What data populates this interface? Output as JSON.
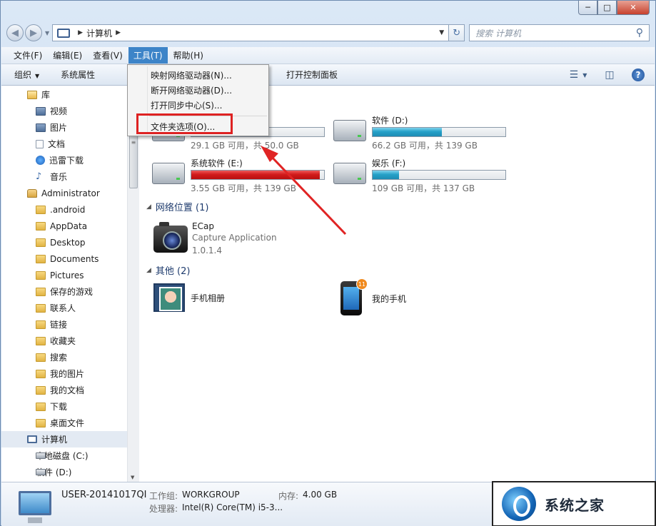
{
  "window": {
    "min": "─",
    "max": "□",
    "close": "✕"
  },
  "address": {
    "path": "计算机",
    "search_placeholder": "搜索 计算机"
  },
  "menubar": [
    "文件(F)",
    "编辑(E)",
    "查看(V)",
    "工具(T)",
    "帮助(H)"
  ],
  "cmdbar": {
    "organize": "组织",
    "system_props": "系统属性",
    "open_cp": "打开控制面板"
  },
  "tools_menu": [
    "映射网络驱动器(N)...",
    "断开网络驱动器(D)...",
    "打开同步中心(S)...",
    "文件夹选项(O)..."
  ],
  "nav": [
    {
      "label": "库",
      "icon": "lib"
    },
    {
      "label": "视频",
      "icon": "media"
    },
    {
      "label": "图片",
      "icon": "media"
    },
    {
      "label": "文档",
      "icon": "doc"
    },
    {
      "label": "迅雷下载",
      "icon": "xl"
    },
    {
      "label": "音乐",
      "icon": "note"
    },
    {
      "label": "Administrator",
      "icon": "user"
    },
    {
      "label": ".android",
      "icon": "folder"
    },
    {
      "label": "AppData",
      "icon": "folder"
    },
    {
      "label": "Desktop",
      "icon": "folder"
    },
    {
      "label": "Documents",
      "icon": "folder"
    },
    {
      "label": "Pictures",
      "icon": "folder"
    },
    {
      "label": "保存的游戏",
      "icon": "folder"
    },
    {
      "label": "联系人",
      "icon": "folder"
    },
    {
      "label": "链接",
      "icon": "folder"
    },
    {
      "label": "收藏夹",
      "icon": "folder"
    },
    {
      "label": "搜索",
      "icon": "folder"
    },
    {
      "label": "我的图片",
      "icon": "folder"
    },
    {
      "label": "我的文档",
      "icon": "folder"
    },
    {
      "label": "下载",
      "icon": "folder"
    },
    {
      "label": "桌面文件",
      "icon": "folder"
    },
    {
      "label": "计算机",
      "icon": "pc"
    },
    {
      "label": "本地磁盘 (C:)",
      "icon": "drive"
    },
    {
      "label": "软件 (D:)",
      "icon": "drive"
    }
  ],
  "drives": [
    {
      "name": "",
      "free": "29.1 GB 可用，共 50.0 GB",
      "used_fraction": 0.42,
      "color": "blue"
    },
    {
      "name": "软件 (D:)",
      "free": "66.2 GB 可用，共 139 GB",
      "used_fraction": 0.52,
      "color": "blue"
    },
    {
      "name": "系统软件 (E:)",
      "free": "3.55 GB 可用，共 139 GB",
      "used_fraction": 0.97,
      "color": "red"
    },
    {
      "name": "娱乐 (F:)",
      "free": "109 GB 可用，共 137 GB",
      "used_fraction": 0.2,
      "color": "blue"
    }
  ],
  "groups": {
    "network": "网络位置 (1)",
    "other": "其他 (2)"
  },
  "ecap": {
    "name": "ECap",
    "desc": "Capture Application",
    "version": "1.0.1.4"
  },
  "other_items": {
    "album": "手机相册",
    "phone": "我的手机",
    "badge": "11"
  },
  "details": {
    "pc_name": "USER-20141017QI",
    "workgroup_label": "工作组:",
    "workgroup": "WORKGROUP",
    "memory_label": "内存:",
    "memory": "4.00 GB",
    "cpu_label": "处理器:",
    "cpu": "Intel(R) Core(TM) i5-3..."
  },
  "watermark": "系统之家",
  "colors": {
    "menu_active": "#3d84c8",
    "highlight": "#de2222",
    "bar_blue": "#26a1c8",
    "bar_red": "#d21b1b"
  }
}
